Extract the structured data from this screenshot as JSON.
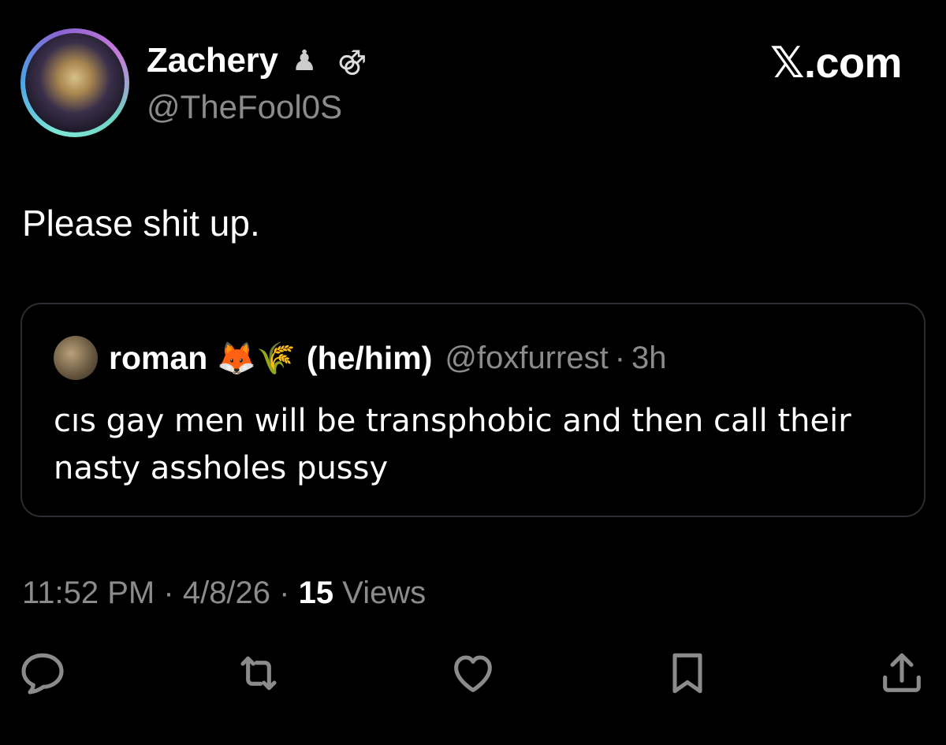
{
  "author": {
    "name": "Zachery",
    "emoji_1": "♟",
    "emoji_2": "⚣",
    "handle": "@TheFool0S"
  },
  "brand": "𝕏.com",
  "tweet": {
    "text": "Please shit up."
  },
  "quote": {
    "name": "roman",
    "emojis": "🦊🌾",
    "pronouns": "(he/him)",
    "handle": "@foxfurrest",
    "separator": "·",
    "time": "3h",
    "text": "cıs gay men will be transphobic and then call their nasty assholes pussy"
  },
  "meta": {
    "time": "11:52 PM",
    "sep1": "·",
    "date": "4/8/26",
    "sep2": "·",
    "views_count": "15",
    "views_label": "Views"
  },
  "actions": {
    "icon_color": "#8b8b8b",
    "icons": [
      "reply-icon",
      "retweet-icon",
      "like-icon",
      "bookmark-icon",
      "share-icon"
    ]
  }
}
